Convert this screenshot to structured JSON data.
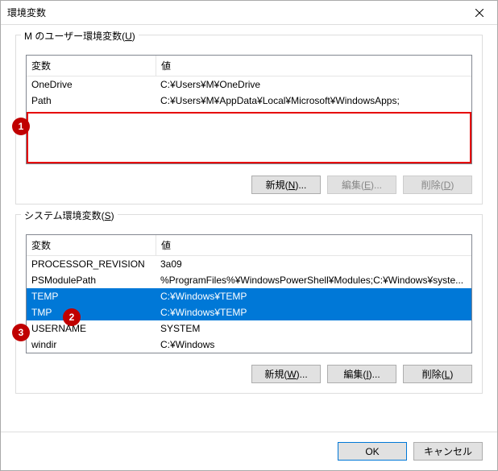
{
  "title": "環境変数",
  "user_section": {
    "label_pre": "M のユーザー環境変数(",
    "label_accel": "U",
    "label_post": ")",
    "headers": {
      "name": "変数",
      "value": "値"
    },
    "rows": [
      {
        "name": "OneDrive",
        "value": "C:¥Users¥M¥OneDrive"
      },
      {
        "name": "Path",
        "value": "C:¥Users¥M¥AppData¥Local¥Microsoft¥WindowsApps;"
      }
    ],
    "buttons": {
      "new_pre": "新規(",
      "new_accel": "N",
      "new_post": ")...",
      "edit_pre": "編集(",
      "edit_accel": "E",
      "edit_post": ")...",
      "del_pre": "削除(",
      "del_accel": "D",
      "del_post": ")"
    }
  },
  "system_section": {
    "label_pre": "システム環境変数(",
    "label_accel": "S",
    "label_post": ")",
    "headers": {
      "name": "変数",
      "value": "値"
    },
    "rows": [
      {
        "name": "PROCESSOR_REVISION",
        "value": "3a09",
        "sel": false
      },
      {
        "name": "PSModulePath",
        "value": "%ProgramFiles%¥WindowsPowerShell¥Modules;C:¥Windows¥syste...",
        "sel": false
      },
      {
        "name": "TEMP",
        "value": "C:¥Windows¥TEMP",
        "sel": true
      },
      {
        "name": "TMP",
        "value": "C:¥Windows¥TEMP",
        "sel": true
      },
      {
        "name": "USERNAME",
        "value": "SYSTEM",
        "sel": false
      },
      {
        "name": "windir",
        "value": "C:¥Windows",
        "sel": false
      }
    ],
    "buttons": {
      "new_pre": "新規(",
      "new_accel": "W",
      "new_post": ")...",
      "edit_pre": "編集(",
      "edit_accel": "I",
      "edit_post": ")...",
      "del_pre": "削除(",
      "del_accel": "L",
      "del_post": ")"
    }
  },
  "footer": {
    "ok": "OK",
    "cancel": "キャンセル"
  },
  "callouts": [
    "1",
    "2",
    "3"
  ]
}
